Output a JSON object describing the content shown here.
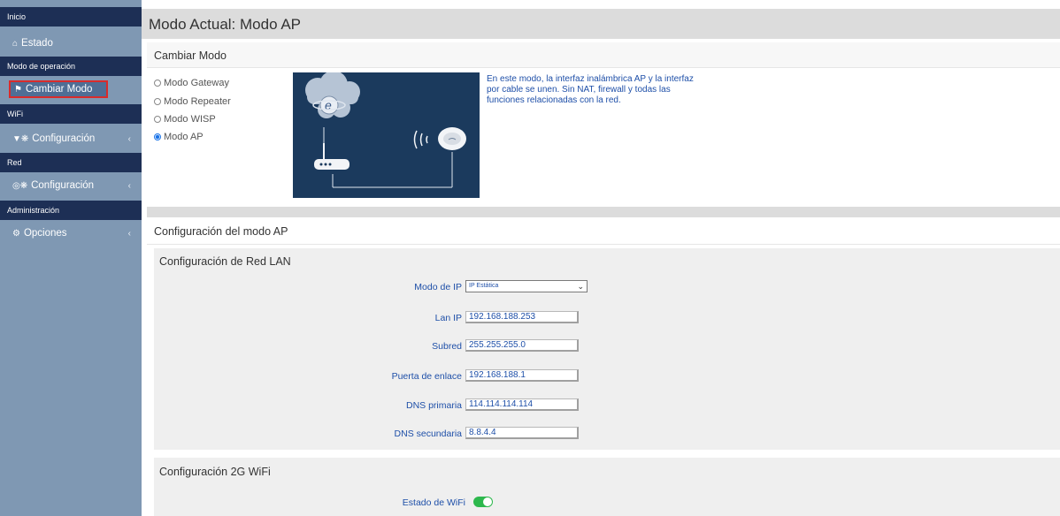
{
  "sidebar": {
    "sections": [
      {
        "header": "Inicio",
        "items": [
          {
            "label": "Estado",
            "icon": "home-icon"
          }
        ]
      },
      {
        "header": "Modo de operación",
        "items": [
          {
            "label": "Cambiar Modo",
            "icon": "flag-icon",
            "active": true
          }
        ]
      },
      {
        "header": "WiFi",
        "items": [
          {
            "label": "Configuración",
            "icon": "wifi-gears-icon"
          }
        ]
      },
      {
        "header": "Red",
        "items": [
          {
            "label": "Configuración",
            "icon": "globe-gears-icon"
          }
        ]
      },
      {
        "header": "Administración",
        "items": [
          {
            "label": "Opciones",
            "icon": "gear-icon"
          }
        ]
      }
    ],
    "chevron": "‹"
  },
  "page": {
    "title": "Modo Actual: Modo AP"
  },
  "change_mode": {
    "title": "Cambiar Modo",
    "options": [
      "Modo Gateway",
      "Modo Repeater",
      "Modo WISP",
      "Modo AP"
    ],
    "selected": "Modo AP",
    "description": "En este modo, la interfaz inalámbrica AP y la interfaz por cable se unen. Sin NAT, firewall y todas las funciones relacionadas con la red."
  },
  "ap_config": {
    "title": "Configuración del modo AP",
    "lan": {
      "title": "Configuración de Red LAN",
      "ip_mode_label": "Modo de IP",
      "ip_mode_value": "IP Estática",
      "fields": [
        {
          "label": "Lan IP",
          "value": "192.168.188.253"
        },
        {
          "label": "Subred",
          "value": "255.255.255.0"
        },
        {
          "label": "Puerta de enlace",
          "value": "192.168.188.1"
        },
        {
          "label": "DNS primaria",
          "value": "114.114.114.114"
        },
        {
          "label": "DNS secundaria",
          "value": "8.8.4.4"
        }
      ]
    },
    "wifi2g": {
      "title": "Configuración 2G WiFi",
      "status_label": "Estado de WiFi",
      "enabled": true
    }
  },
  "colors": {
    "sidebar_bg": "#7f98b3",
    "section_header_bg": "#1d2f55",
    "active_outline": "#d92b2b",
    "link_blue": "#1e4fa8",
    "toggle_on": "#2db84d"
  }
}
